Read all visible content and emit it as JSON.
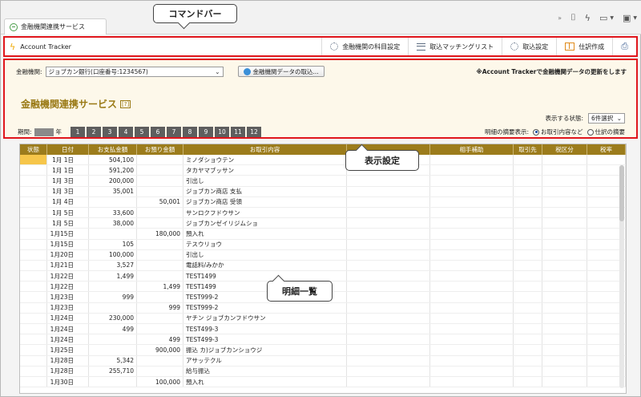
{
  "tab": {
    "title": "金融機関連携サービス"
  },
  "toolbar_icons": [
    "double-chevron-icon",
    "bookmark-icon",
    "bolt-icon",
    "window-icon",
    "calendar-icon"
  ],
  "command_bar": {
    "app_name": "Account Tracker",
    "buttons": [
      "金融機関の科目設定",
      "取込マッチングリスト",
      "取込設定",
      "仕訳作成"
    ],
    "print_icon": "printer-icon"
  },
  "settings": {
    "bank_label": "金融機関:",
    "bank_value": "ジョブカン銀行(口座番号:1234567)",
    "fetch_button": "金融機関データの取込...",
    "note": "※Account Trackerで金融機関データの更新をします",
    "service_title": "金融機関連携サービス",
    "help_mark": "[?]",
    "state_label": "表示する状態:",
    "state_value": "6件選択",
    "period_label": "期間:",
    "year_suffix": "年",
    "months": [
      "1",
      "2",
      "3",
      "4",
      "5",
      "6",
      "7",
      "8",
      "9",
      "10",
      "11",
      "12"
    ],
    "detail_label": "明細の摘要表示:",
    "detail_options": [
      {
        "label": "お取引内容など",
        "selected": true
      },
      {
        "label": "仕訳の摘要",
        "selected": false
      }
    ]
  },
  "table": {
    "headers": [
      "状態",
      "日付",
      "お支払金額",
      "お預り金額",
      "お取引内容",
      "",
      "相手補助",
      "取引先",
      "税区分",
      "税率"
    ],
    "rows": [
      [
        "",
        "1月 1日",
        "504,100",
        "",
        "ミノダショウテン"
      ],
      [
        "",
        "1月 1日",
        "591,200",
        "",
        "タカヤマブッサン"
      ],
      [
        "",
        "1月 3日",
        "200,000",
        "",
        "引出し"
      ],
      [
        "",
        "1月 3日",
        "35,001",
        "",
        "ジョブカン商店 支払"
      ],
      [
        "",
        "1月 4日",
        "",
        "50,001",
        "ジョブカン商店 受領"
      ],
      [
        "",
        "1月 5日",
        "33,600",
        "",
        "サンロクフドウサン"
      ],
      [
        "",
        "1月 5日",
        "38,000",
        "",
        "ジョブカンゼイリジムショ"
      ],
      [
        "",
        "1月15日",
        "",
        "180,000",
        "預入れ"
      ],
      [
        "",
        "1月15日",
        "105",
        "",
        "テスウリョウ"
      ],
      [
        "",
        "1月20日",
        "100,000",
        "",
        "引出し"
      ],
      [
        "",
        "1月21日",
        "3,527",
        "",
        "電話料/みかか"
      ],
      [
        "",
        "1月22日",
        "1,499",
        "",
        "TEST1499"
      ],
      [
        "",
        "1月22日",
        "",
        "1,499",
        "TEST1499"
      ],
      [
        "",
        "1月23日",
        "999",
        "",
        "TEST999-2"
      ],
      [
        "",
        "1月23日",
        "",
        "999",
        "TEST999-2"
      ],
      [
        "",
        "1月24日",
        "230,000",
        "",
        "ヤチン ジョブカンフドウサン"
      ],
      [
        "",
        "1月24日",
        "499",
        "",
        "TEST499-3"
      ],
      [
        "",
        "1月24日",
        "",
        "499",
        "TEST499-3"
      ],
      [
        "",
        "1月25日",
        "",
        "900,000",
        "振込 カ)ジョブカンショウジ"
      ],
      [
        "",
        "1月28日",
        "5,342",
        "",
        "アサッテクル"
      ],
      [
        "",
        "1月28日",
        "255,710",
        "",
        "給与振込"
      ],
      [
        "",
        "1月30日",
        "",
        "100,000",
        "預入れ"
      ]
    ]
  },
  "callouts": {
    "command_bar": "コマンドバー",
    "display_settings": "表示設定",
    "detail_list": "明細一覧"
  },
  "colors": {
    "accent_red": "#e0161c",
    "header_gold": "#9c7c1c",
    "panel_bg": "#fdf8ea",
    "month_button": "#5e5e5e",
    "status_highlight": "#f6c64a"
  }
}
